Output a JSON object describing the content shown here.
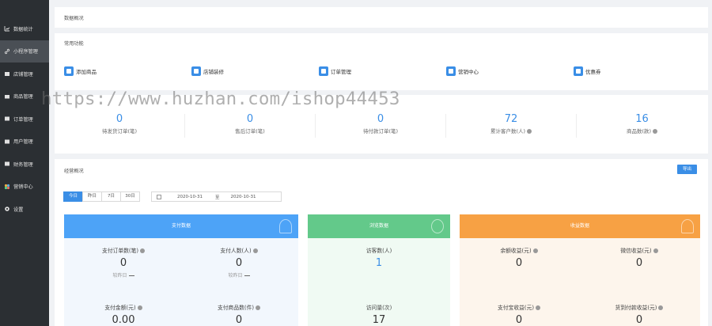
{
  "sidebar": {
    "items": [
      {
        "label": "数据统计",
        "icon": "chart-icon",
        "active": false
      },
      {
        "label": "小程序管理",
        "icon": "link-icon",
        "active": true
      },
      {
        "label": "店铺管理",
        "icon": "shop-icon",
        "active": false
      },
      {
        "label": "商品管理",
        "icon": "goods-icon",
        "active": false
      },
      {
        "label": "订单管理",
        "icon": "order-icon",
        "active": false
      },
      {
        "label": "用户管理",
        "icon": "user-icon",
        "active": false
      },
      {
        "label": "财务管理",
        "icon": "finance-icon",
        "active": false
      },
      {
        "label": "营销中心",
        "icon": "marketing-icon",
        "active": false
      },
      {
        "label": "设置",
        "icon": "settings-icon",
        "active": false
      }
    ]
  },
  "overview": {
    "title": "数据概况"
  },
  "common": {
    "title": "常用功能",
    "items": [
      {
        "label": "添加商品"
      },
      {
        "label": "店铺装修"
      },
      {
        "label": "订单管理"
      },
      {
        "label": "营销中心"
      },
      {
        "label": "优惠券"
      }
    ]
  },
  "watermark": "https://www.huzhan.com/ishop44453",
  "stats": [
    {
      "value": "0",
      "label": "待发货订单(笔)"
    },
    {
      "value": "0",
      "label": "售后订单(笔)"
    },
    {
      "value": "0",
      "label": "待付款订单(笔)"
    },
    {
      "value": "72",
      "label": "累计客户数(人)"
    },
    {
      "value": "16",
      "label": "商品数(款)"
    }
  ],
  "business": {
    "title": "经营概况",
    "export_label": "导出",
    "tabs": [
      "今日",
      "昨日",
      "7日",
      "30日"
    ],
    "date_start": "2020-10-31",
    "date_sep": "至",
    "date_end": "2020-10-31"
  },
  "panels": {
    "pay": {
      "title": "支付数据",
      "color": "#4da3f7",
      "metrics": [
        {
          "label": "支付订单数(笔)",
          "value": "0",
          "sub": "较昨日"
        },
        {
          "label": "支付人数(人)",
          "value": "0",
          "sub": "较昨日"
        },
        {
          "label": "支付金额(元)",
          "value": "0.00"
        },
        {
          "label": "支付商品数(件)",
          "value": "0"
        }
      ]
    },
    "visit": {
      "title": "浏览数据",
      "color": "#63c98a",
      "metrics": [
        {
          "label": "访客数(人)",
          "value": "1"
        },
        {
          "label": "访问量(次)",
          "value": "17"
        }
      ]
    },
    "income": {
      "title": "收益数据",
      "color": "#f7a144",
      "metrics": [
        {
          "label": "余额收益(元)",
          "value": "0"
        },
        {
          "label": "微信收益(元)",
          "value": "0"
        },
        {
          "label": "支付宝收益(元)",
          "value": "0"
        },
        {
          "label": "货到付款收益(元)",
          "value": "0"
        }
      ]
    }
  }
}
